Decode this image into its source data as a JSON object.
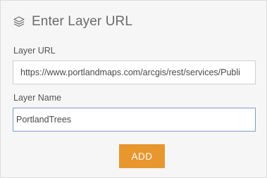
{
  "header": {
    "icon": "layers-icon",
    "title": "Enter Layer URL"
  },
  "form": {
    "url_label": "Layer URL",
    "url_value": "https://www.portlandmaps.com/arcgis/rest/services/Publi",
    "name_label": "Layer Name",
    "name_value": "PortlandTrees",
    "add_label": "ADD"
  },
  "colors": {
    "accent": "#e8962e",
    "focus_border": "#7aa0c8"
  }
}
